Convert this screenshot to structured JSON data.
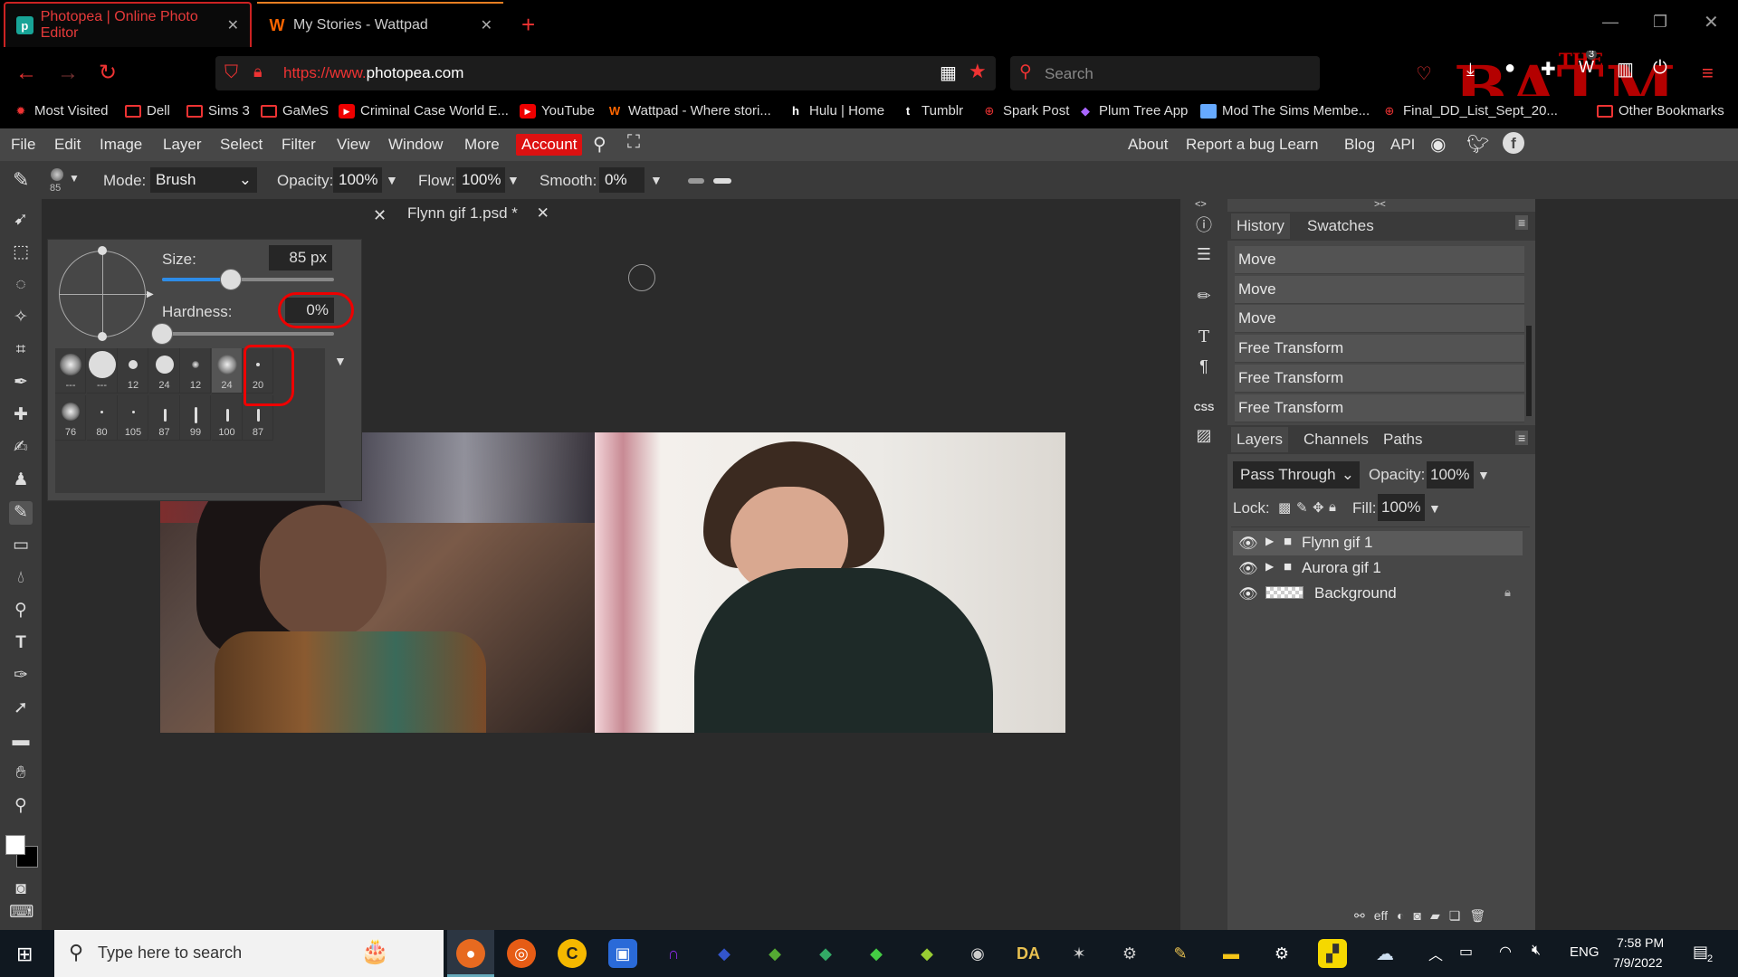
{
  "browser": {
    "tabs": [
      {
        "title": "Photopea | Online Photo Editor",
        "icon": "photopea-icon",
        "active": true
      },
      {
        "title": "My Stories - Wattpad",
        "icon": "wattpad-icon",
        "active": false
      }
    ],
    "new_tab": "+",
    "url_protocol": "https://www.",
    "url_domain": "photopea.com",
    "search_placeholder": "Search",
    "theme_text_small": "THE",
    "theme_text_big": "BATMAN",
    "notif_count": "3",
    "bookmarks": [
      {
        "label": "Most Visited",
        "icon": "gear-icon"
      },
      {
        "label": "Dell",
        "icon": "folder-icon"
      },
      {
        "label": "Sims 3",
        "icon": "folder-icon"
      },
      {
        "label": "GaMeS",
        "icon": "folder-icon"
      },
      {
        "label": "Criminal Case World E...",
        "icon": "youtube-icon"
      },
      {
        "label": "YouTube",
        "icon": "youtube-icon"
      },
      {
        "label": "Wattpad - Where stori...",
        "icon": "wattpad-icon"
      },
      {
        "label": "Hulu | Home",
        "icon": "hulu-icon"
      },
      {
        "label": "Tumblr",
        "icon": "tumblr-icon"
      },
      {
        "label": "Spark Post",
        "icon": "globe-icon"
      },
      {
        "label": "Plum Tree App",
        "icon": "plum-icon"
      },
      {
        "label": "Mod The Sims Membe...",
        "icon": "image-icon"
      },
      {
        "label": "Final_DD_List_Sept_20...",
        "icon": "globe-icon"
      },
      {
        "label": "Other Bookmarks",
        "icon": "folder-icon"
      }
    ]
  },
  "photopea": {
    "menu": [
      "File",
      "Edit",
      "Image",
      "Layer",
      "Select",
      "Filter",
      "View",
      "Window",
      "More"
    ],
    "account": "Account",
    "menu_right": [
      "About",
      "Report a bug",
      "Learn",
      "Blog",
      "API"
    ],
    "options": {
      "brush_size_badge": "85",
      "mode_label": "Mode:",
      "mode_value": "Brush",
      "opacity_label": "Opacity:",
      "opacity_value": "100%",
      "flow_label": "Flow:",
      "flow_value": "100%",
      "smooth_label": "Smooth:",
      "smooth_value": "0%"
    },
    "brush_panel": {
      "size_label": "Size:",
      "size_value": "85",
      "size_unit": "px",
      "size_fraction": 0.4,
      "hardness_label": "Hardness:",
      "hardness_value": "0%",
      "hardness_fraction": 0.0,
      "presets": [
        "---",
        "---",
        "12",
        "24",
        "12",
        "24",
        "20",
        "76",
        "80",
        "105",
        "87",
        "99",
        "100",
        "87"
      ]
    },
    "document_tab": "Flynn gif 1.psd *",
    "history_tabs": [
      "History",
      "Swatches"
    ],
    "history": [
      "Move",
      "Move",
      "Move",
      "Free Transform",
      "Free Transform",
      "Free Transform"
    ],
    "layers_tabs": [
      "Layers",
      "Channels",
      "Paths"
    ],
    "blend_mode": "Pass Through",
    "layer_opacity_label": "Opacity:",
    "layer_opacity": "100%",
    "lock_label": "Lock:",
    "fill_label": "Fill:",
    "fill_value": "100%",
    "layers": [
      {
        "name": "Flynn gif 1",
        "type": "folder",
        "selected": true
      },
      {
        "name": "Aurora gif 1",
        "type": "folder",
        "selected": false
      },
      {
        "name": "Background",
        "type": "image",
        "selected": false
      }
    ],
    "side_label_css": "CSS"
  },
  "taskbar": {
    "search_placeholder": "Type here to search",
    "time": "7:58 PM",
    "date": "7/9/2022",
    "lang": "ENG",
    "notif_count": "2"
  }
}
